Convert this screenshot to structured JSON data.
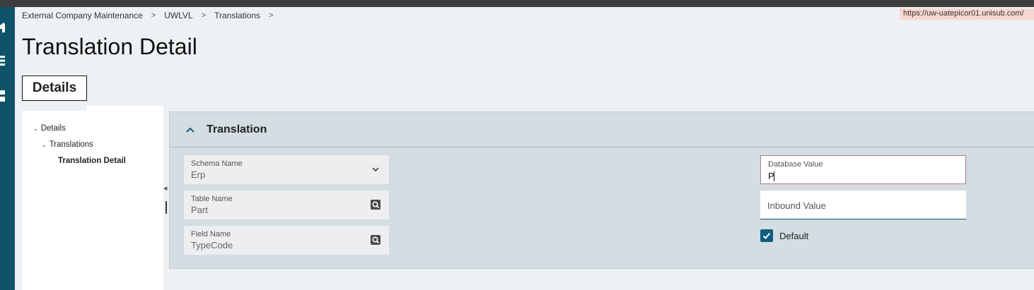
{
  "breadcrumb": {
    "items": [
      "External Company Maintenance",
      "UWLVL",
      "Translations"
    ],
    "separator": ">"
  },
  "url_badge": "https://uw-uatepicor01.unisub.com/",
  "page_title": "Translation Detail",
  "tabs": {
    "details": "Details"
  },
  "tree": {
    "items": [
      "Details",
      "Translations",
      "Translation Detail"
    ]
  },
  "panel": {
    "title": "Translation",
    "schema_name": {
      "label": "Schema Name",
      "value": "Erp"
    },
    "table_name": {
      "label": "Table Name",
      "value": "Part"
    },
    "field_name": {
      "label": "Field Name",
      "value": "TypeCode"
    },
    "database_value": {
      "label": "Database Value",
      "value": "P"
    },
    "inbound_value": {
      "placeholder": "Inbound Value",
      "value": ""
    },
    "default_checkbox": {
      "label": "Default",
      "checked": true
    }
  },
  "icons": {
    "rail": [
      "home-icon",
      "menu-icon",
      "grid-icon"
    ],
    "lookup": "search-lookup-icon",
    "dropdown": "chevron-down-icon",
    "collapse": "chevron-up-icon"
  },
  "colors": {
    "rail": "#0f5368",
    "panel": "#d3dde2",
    "checkbox": "#0f5c80",
    "url_badge_bg": "#f7d7d0"
  }
}
